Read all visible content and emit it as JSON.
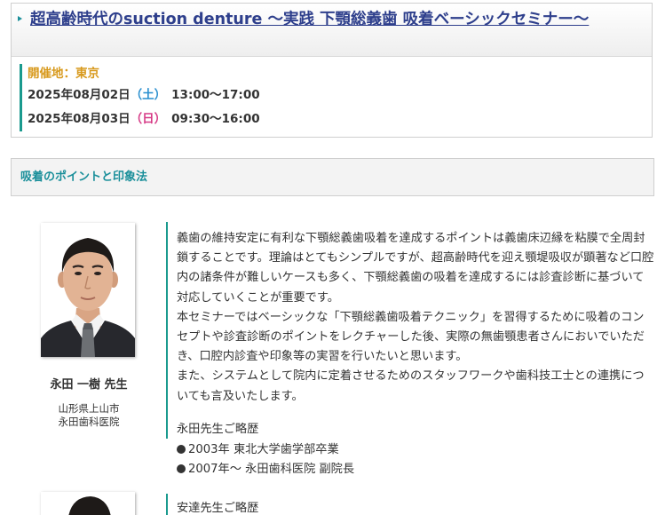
{
  "event": {
    "title": "超高齢時代のsuction denture 〜実践 下顎総義歯 吸着ベーシックセミナー〜",
    "venue": "開催地：東京",
    "dates": [
      {
        "date": "2025年08月02日",
        "dow": "（土）",
        "time": "13:00〜17:00"
      },
      {
        "date": "2025年08月03日",
        "dow": "（日）",
        "time": "09:30〜16:00"
      }
    ]
  },
  "section": {
    "title": "吸着のポイントと印象法"
  },
  "speaker1": {
    "name": "永田 一樹 先生",
    "affiliation_line1": "山形県上山市",
    "affiliation_line2": "永田歯科医院",
    "description": [
      "義歯の維持安定に有利な下顎総義歯吸着を達成するポイントは義歯床辺縁を粘膜で全周封鎖することです。理論はとてもシンプルですが、超高齢時代を迎え顎堤吸収が顕著など口腔内の諸条件が難しいケースも多く、下顎総義歯の吸着を達成するには診査診断に基づいて対応していくことが重要です。",
      "本セミナーではベーシックな「下顎総義歯吸着テクニック」を習得するために吸着のコンセプトや診査診断のポイントをレクチャーした後、実際の無歯顎患者さんにおいでいただき、口腔内診査や印象等の実習を行いたいと思います。",
      "また、システムとして院内に定着させるためのスタッフワークや歯科技工士との連携についても言及いたします。"
    ],
    "career_heading": "永田先生ご略歴",
    "career": [
      "2003年 東北大学歯学部卒業",
      "2007年〜 永田歯科医院 副院長"
    ]
  },
  "speaker2": {
    "career_heading": "安達先生ご略歴"
  },
  "colors": {
    "title": "#2e3f8c",
    "accent_teal": "#1a9a8e",
    "venue": "#d89a1e",
    "saturday": "#2a8fcf",
    "sunday": "#d63a86"
  }
}
